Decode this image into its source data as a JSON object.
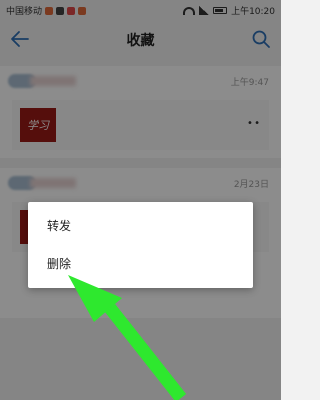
{
  "status_bar": {
    "carrier": "中国移动",
    "time": "上午10:20"
  },
  "header": {
    "title": "收藏"
  },
  "favorites": [
    {
      "time": "上午9:47",
      "thumb_text": "学习"
    },
    {
      "time": "2月23日"
    }
  ],
  "context_menu": {
    "items": [
      "转发",
      "删除"
    ]
  },
  "colors": {
    "accent": "#2f6fb6",
    "arrow": "#2ee82e",
    "thumb": "#9b1b16"
  },
  "icons": [
    "back-arrow-icon",
    "search-icon",
    "wifi-icon",
    "signal-icon",
    "battery-icon",
    "more-icon"
  ]
}
